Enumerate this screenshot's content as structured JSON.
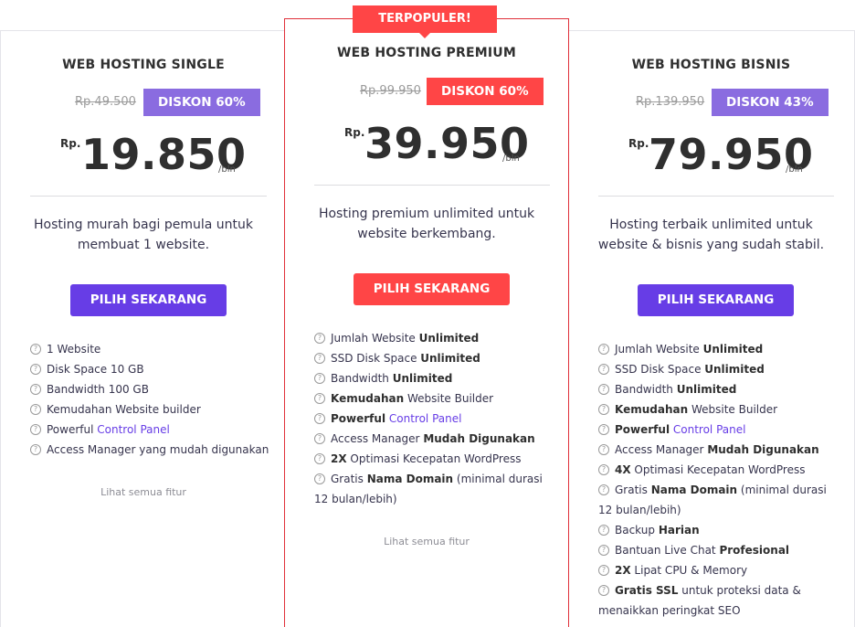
{
  "plans": [
    {
      "title": "WEB HOSTING SINGLE",
      "old_price": "Rp.49.500",
      "discount": "DISKON 60%",
      "currency": "Rp.",
      "price": "19.850",
      "period": "/bln",
      "description": "Hosting murah bagi pemula untuk membuat 1 website.",
      "button": "PILIH SEKARANG",
      "features": [
        {
          "text": "1 Website"
        },
        {
          "text": "Disk Space 10 GB"
        },
        {
          "text": "Bandwidth 100 GB"
        },
        {
          "text": "Kemudahan Website builder"
        },
        {
          "pre": "Powerful ",
          "link": "Control Panel"
        },
        {
          "text": "Access Manager yang mudah digunakan"
        }
      ],
      "see_all": "Lihat semua fitur"
    },
    {
      "badge": "TERPOPULER!",
      "title": "WEB HOSTING PREMIUM",
      "old_price": "Rp.99.950",
      "discount": "DISKON 60%",
      "currency": "Rp.",
      "price": "39.950",
      "period": "/bln",
      "description": "Hosting premium unlimited untuk website berkembang.",
      "button": "PILIH SEKARANG",
      "features": [
        {
          "text": "Jumlah Website ",
          "bold": "Unlimited"
        },
        {
          "text": "SSD Disk Space ",
          "bold": "Unlimited"
        },
        {
          "text": "Bandwidth ",
          "bold": "Unlimited"
        },
        {
          "bold_pre": "Kemudahan",
          "text": " Website Builder"
        },
        {
          "bold_pre": "Powerful",
          "link": " Control Panel"
        },
        {
          "text": "Access Manager ",
          "bold": "Mudah Digunakan"
        },
        {
          "bold_pre": "2X",
          "text": " Optimasi Kecepatan WordPress"
        },
        {
          "text": "Gratis ",
          "bold": "Nama Domain",
          "tail": " (minimal durasi 12 bulan/lebih)"
        }
      ],
      "see_all": "Lihat semua fitur"
    },
    {
      "title": "WEB HOSTING BISNIS",
      "old_price": "Rp.139.950",
      "discount": "DISKON 43%",
      "currency": "Rp.",
      "price": "79.950",
      "period": "/bln",
      "description": "Hosting terbaik unlimited untuk website & bisnis yang sudah stabil.",
      "button": "PILIH SEKARANG",
      "features": [
        {
          "text": "Jumlah Website ",
          "bold": "Unlimited"
        },
        {
          "text": "SSD Disk Space ",
          "bold": "Unlimited"
        },
        {
          "text": "Bandwidth ",
          "bold": "Unlimited"
        },
        {
          "bold_pre": "Kemudahan",
          "text": " Website Builder"
        },
        {
          "bold_pre": "Powerful",
          "link": " Control Panel"
        },
        {
          "text": "Access Manager ",
          "bold": "Mudah Digunakan"
        },
        {
          "bold_pre": "4X",
          "text": " Optimasi Kecepatan WordPress"
        },
        {
          "text": "Gratis ",
          "bold": "Nama Domain",
          "tail": " (minimal durasi 12 bulan/lebih)"
        },
        {
          "text": "Backup ",
          "bold": "Harian"
        },
        {
          "text": "Bantuan Live Chat ",
          "bold": "Profesional"
        },
        {
          "bold_pre": "2X",
          "text": " Lipat CPU & Memory"
        },
        {
          "bold_pre": "Gratis SSL",
          "text": " untuk proteksi data & menaikkan peringkat SEO"
        }
      ]
    }
  ],
  "colors": {
    "purple": "#673de6",
    "light_purple": "#8a6ce0",
    "red": "#ff4546"
  },
  "icon": "question-circle-icon"
}
